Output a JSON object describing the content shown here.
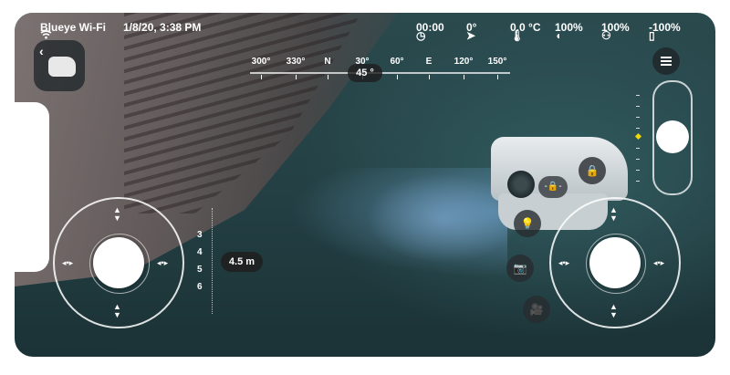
{
  "status": {
    "wifi_icon": "wifi-icon",
    "network": "Blueye Wi-Fi",
    "datetime": "1/8/20, 3:38 PM",
    "timer": "00:00",
    "tilt": "0°",
    "temperature": "0.0 °C",
    "drone_battery": "100%",
    "controller_battery": "100%",
    "phone_battery": "-100%"
  },
  "compass": {
    "labels": [
      "300°",
      "330°",
      "N",
      "30°",
      "60°",
      "E",
      "120°",
      "150°"
    ],
    "heading": "45 °"
  },
  "depth": {
    "scale": [
      "3",
      "4",
      "5",
      "6"
    ],
    "current": "4.5 m"
  },
  "controls": {
    "back_label": "‹",
    "lock_label": "-🔒-"
  },
  "colors": {
    "accent": "#f0d900",
    "water": "#2a4a4e"
  },
  "camera_tilt_level": 0.5
}
